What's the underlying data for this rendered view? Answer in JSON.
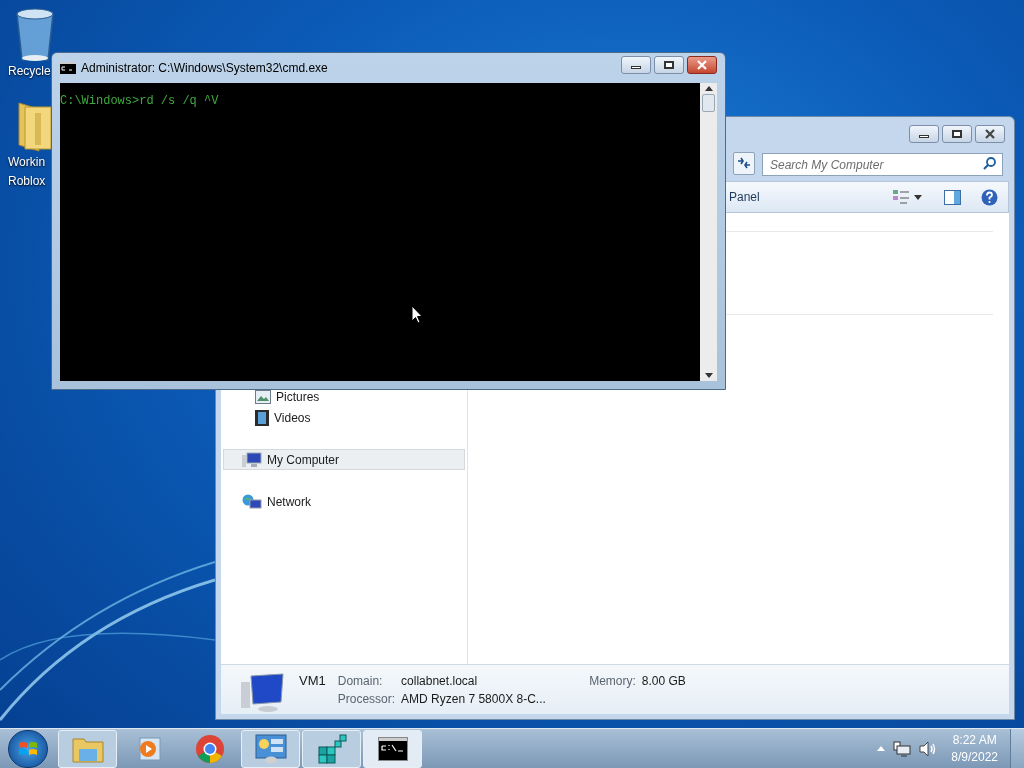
{
  "desktop_icons": [
    {
      "kind": "recycle-bin",
      "lines": [
        "Recycle"
      ]
    },
    {
      "kind": "folder",
      "lines": [
        "Workin",
        "Roblox"
      ]
    }
  ],
  "cmd_window": {
    "title": "Administrator: C:\\Windows\\System32\\cmd.exe",
    "console_lines": [
      "C:\\Windows>rd /s /q ^V"
    ]
  },
  "explorer_window": {
    "search": {
      "placeholder": "Search My Computer"
    },
    "command_bar": {
      "label": "Panel"
    },
    "nav_items": [
      {
        "kind": "pictures",
        "label": "Pictures",
        "selected": false,
        "indented": true
      },
      {
        "kind": "videos",
        "label": "Videos",
        "selected": false,
        "indented": true
      },
      {
        "kind": "computer",
        "label": "My Computer",
        "selected": true,
        "indented": false
      },
      {
        "kind": "network",
        "label": "Network",
        "selected": false,
        "indented": false
      }
    ],
    "details": {
      "name": "VM1",
      "fields": [
        {
          "label": "Domain:",
          "value": "collabnet.local"
        },
        {
          "label": "Memory:",
          "value": "8.00 GB"
        },
        {
          "label": "Processor:",
          "value": "AMD Ryzen 7 5800X 8-C..."
        }
      ]
    }
  },
  "taskbar": {
    "items": [
      {
        "kind": "explorer",
        "running": true,
        "selected": false
      },
      {
        "kind": "media-player",
        "running": false,
        "selected": false
      },
      {
        "kind": "chrome",
        "running": false,
        "selected": false
      },
      {
        "kind": "control-panel",
        "running": true,
        "selected": false
      },
      {
        "kind": "registry",
        "running": true,
        "selected": false
      },
      {
        "kind": "cmd",
        "running": true,
        "selected": true
      }
    ],
    "clock": {
      "time": "8:22 AM",
      "date": "8/9/2022"
    }
  }
}
